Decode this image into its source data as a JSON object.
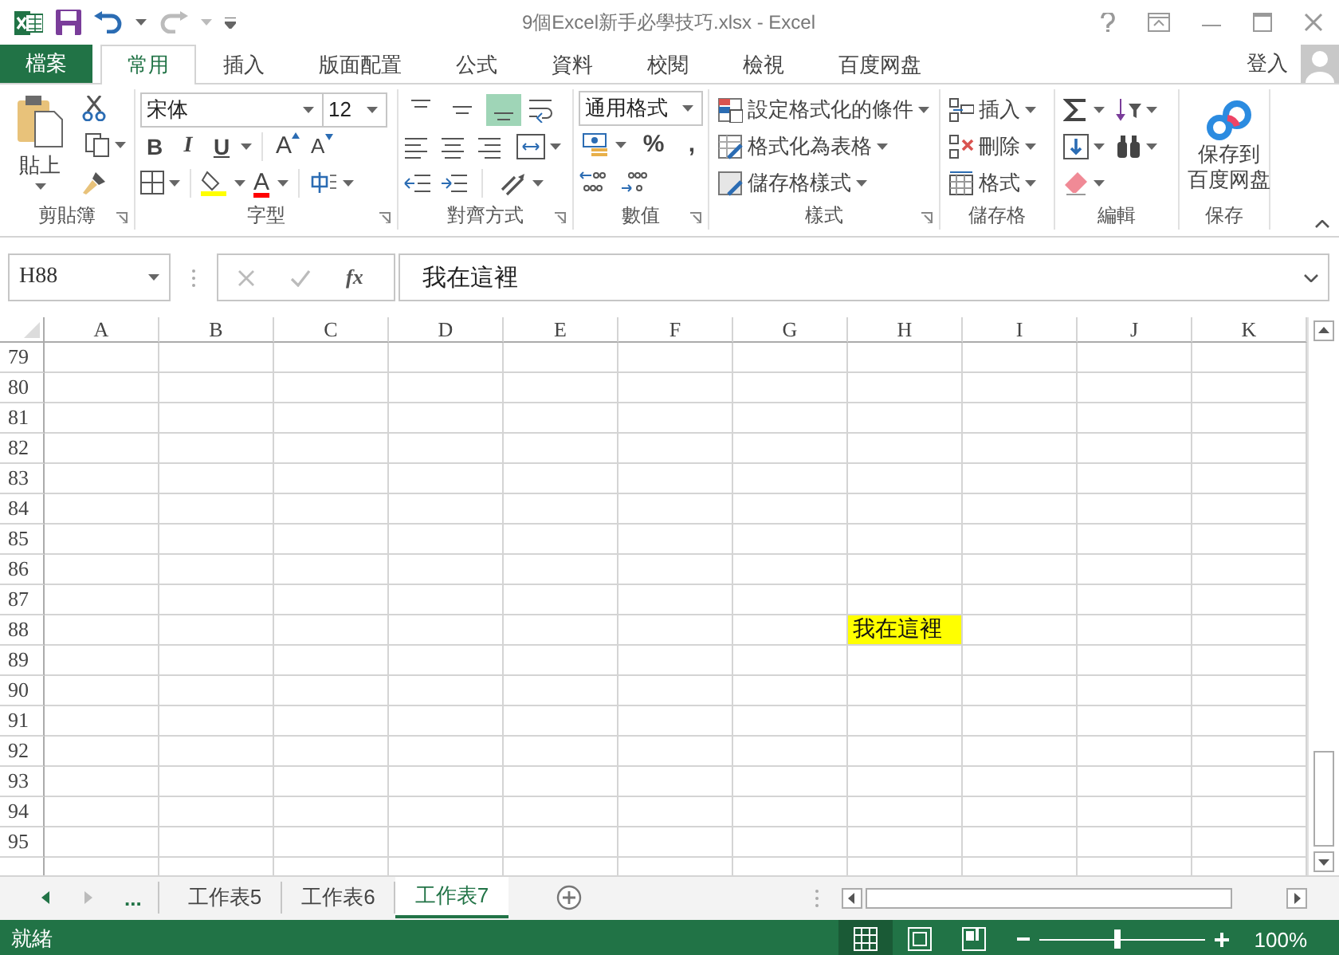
{
  "title_bar": {
    "title": "9個Excel新手必學技巧.xlsx - Excel"
  },
  "tabs": [
    {
      "label": "檔案",
      "kind": "file",
      "selected": false
    },
    {
      "label": "常用",
      "kind": "tab",
      "selected": true
    },
    {
      "label": "插入",
      "kind": "tab",
      "selected": false
    },
    {
      "label": "版面配置",
      "kind": "tab",
      "selected": false
    },
    {
      "label": "公式",
      "kind": "tab",
      "selected": false
    },
    {
      "label": "資料",
      "kind": "tab",
      "selected": false
    },
    {
      "label": "校閱",
      "kind": "tab",
      "selected": false
    },
    {
      "label": "檢視",
      "kind": "tab",
      "selected": false
    },
    {
      "label": "百度网盘",
      "kind": "tab",
      "selected": false
    }
  ],
  "account": {
    "sign_in": "登入"
  },
  "ribbon": {
    "clipboard": {
      "label": "剪貼簿",
      "paste": "貼上"
    },
    "font": {
      "label": "字型",
      "font_name": "宋体",
      "font_size": "12",
      "style_buttons": [
        "B",
        "I",
        "U"
      ],
      "size_buttons": [
        "A",
        "A"
      ],
      "font_color": "A"
    },
    "alignment": {
      "label": "對齊方式",
      "vertical": [
        {
          "kind": "top",
          "selected": false
        },
        {
          "kind": "middle",
          "selected": false
        },
        {
          "kind": "bottom",
          "selected": true
        }
      ]
    },
    "number": {
      "label": "數值",
      "format": "通用格式",
      "symbols": [
        "%",
        ","
      ]
    },
    "styles": {
      "label": "樣式",
      "items": [
        "設定格式化的條件",
        "格式化為表格",
        "儲存格樣式"
      ]
    },
    "cells": {
      "label": "儲存格",
      "items": [
        "插入",
        "刪除",
        "格式"
      ]
    },
    "editing": {
      "label": "編輯"
    },
    "save": {
      "label": "保存",
      "button": [
        "保存到",
        "百度网盘"
      ]
    }
  },
  "formula_bar": {
    "name_box": "H88",
    "function_label": "fx",
    "content": "我在這裡"
  },
  "grid": {
    "columns": [
      "A",
      "B",
      "C",
      "D",
      "E",
      "F",
      "G",
      "H",
      "I",
      "J",
      "K"
    ],
    "rows": [
      {
        "header": "79"
      },
      {
        "header": "80"
      },
      {
        "header": "81"
      },
      {
        "header": "82"
      },
      {
        "header": "83"
      },
      {
        "header": "84"
      },
      {
        "header": "85"
      },
      {
        "header": "86"
      },
      {
        "header": "87"
      },
      {
        "header": "88",
        "cells": [
          {
            "kind": "empty"
          },
          {
            "kind": "empty"
          },
          {
            "kind": "empty"
          },
          {
            "kind": "empty"
          },
          {
            "kind": "empty"
          },
          {
            "kind": "empty"
          },
          {
            "kind": "empty"
          },
          {
            "kind": "text",
            "text": "我在這裡",
            "highlighted": true
          }
        ]
      },
      {
        "header": "89"
      },
      {
        "header": "90"
      },
      {
        "header": "91"
      },
      {
        "header": "92"
      },
      {
        "header": "93"
      },
      {
        "header": "94"
      },
      {
        "header": "95"
      }
    ]
  },
  "sheet_bar": {
    "more": "...",
    "tabs": [
      {
        "label": "工作表5",
        "selected": false
      },
      {
        "label": "工作表6",
        "selected": false
      },
      {
        "label": "工作表7",
        "selected": true
      }
    ]
  },
  "status_bar": {
    "status": "就緒",
    "views": [
      {
        "kind": "normal",
        "selected": true
      },
      {
        "kind": "page_layout",
        "selected": false
      },
      {
        "kind": "page_break",
        "selected": false
      }
    ],
    "zoom": {
      "level": 0.47,
      "reading": "100%"
    }
  }
}
